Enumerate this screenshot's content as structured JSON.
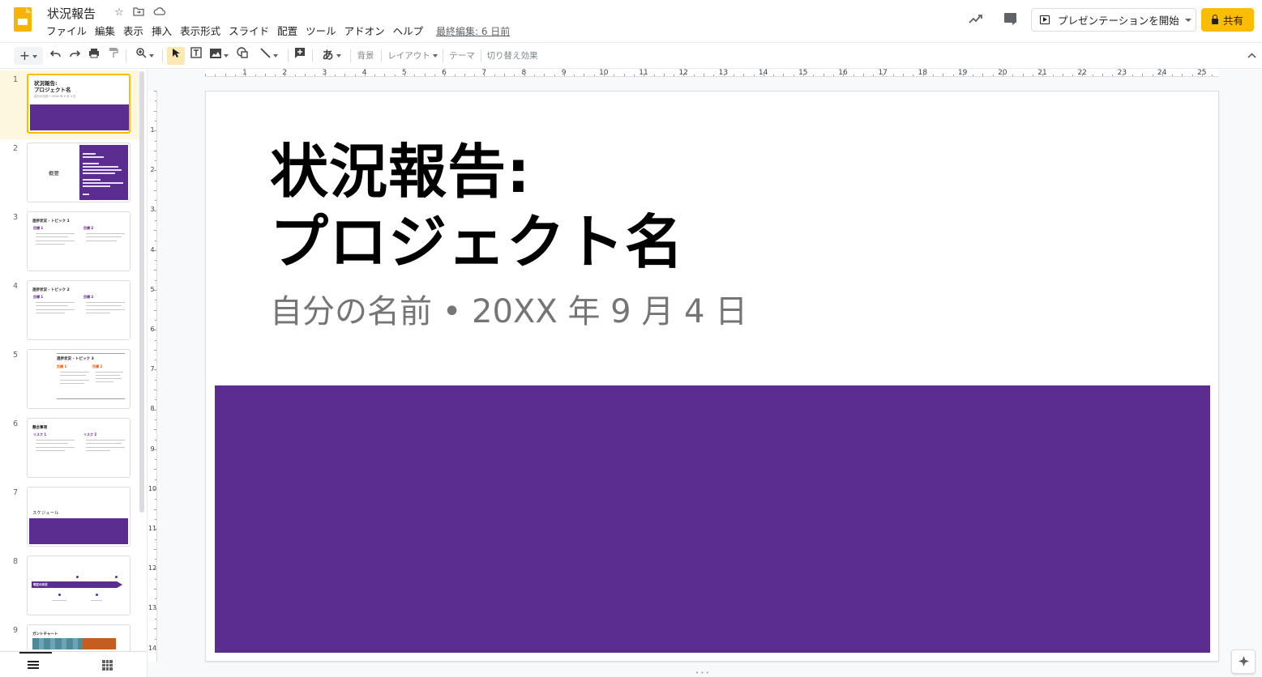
{
  "header": {
    "doc_title": "状況報告",
    "menu": [
      "ファイル",
      "編集",
      "表示",
      "挿入",
      "表示形式",
      "スライド",
      "配置",
      "ツール",
      "アドオン",
      "ヘルプ"
    ],
    "last_edit": "最終編集: 6 日前",
    "present_label": "プレゼンテーションを開始",
    "share_label": "共有"
  },
  "toolbar": {
    "add_label": "+",
    "font_label": "あ",
    "background_label": "背景",
    "layout_label": "レイアウト",
    "theme_label": "テーマ",
    "transition_label": "切り替え効果"
  },
  "filmstrip": {
    "slides": [
      {
        "num": "1",
        "title": "状況報告:\nプロジェクト名",
        "subtitle": "自分の名前 • 20XX 年 9 月 4 日"
      },
      {
        "num": "2",
        "title": "概要"
      },
      {
        "num": "3",
        "title": "進捗状況 - トピック 1",
        "label_a": "目標 1",
        "label_b": "目標 2"
      },
      {
        "num": "4",
        "title": "進捗状況 - トピック 2",
        "label_a": "目標 1",
        "label_b": "目標 2"
      },
      {
        "num": "5",
        "title": "進捗状況 - トピック 3",
        "label_a": "目標 1",
        "label_b": "目標 2"
      },
      {
        "num": "6",
        "title": "懸念事項",
        "label_a": "リスク 1",
        "label_b": "リスク 2"
      },
      {
        "num": "7",
        "title": "スケジュール"
      },
      {
        "num": "8",
        "title": "現在の状況"
      },
      {
        "num": "9",
        "title": "ガントチャート"
      }
    ]
  },
  "ruler": {
    "h_numbers": [
      "1",
      "2",
      "3",
      "4",
      "5",
      "6",
      "7",
      "8",
      "9",
      "10",
      "11",
      "12",
      "13",
      "14",
      "15",
      "16",
      "17",
      "18",
      "19",
      "20",
      "21",
      "22",
      "23",
      "24",
      "25"
    ],
    "v_numbers": [
      "1",
      "2",
      "3",
      "4",
      "5",
      "6",
      "7",
      "8",
      "9",
      "10",
      "11",
      "12",
      "13",
      "14"
    ]
  },
  "slide": {
    "title": "状況報告:\nプロジェクト名",
    "subtitle": "自分の名前 • 20XX 年 9 月 4 日"
  },
  "colors": {
    "accent_purple": "#5c2d91",
    "share_yellow": "#fbbc04"
  }
}
